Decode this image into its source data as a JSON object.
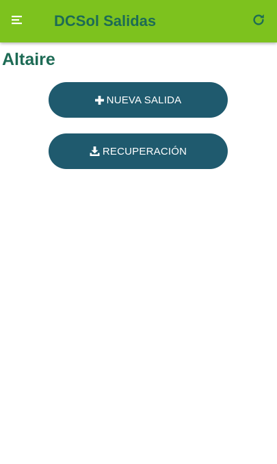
{
  "toolbar": {
    "title": "DCSol Salidas",
    "menu_icon": "menu-icon",
    "refresh_icon": "refresh-icon",
    "background_color": "#7dc21e",
    "title_color": "#1d6b55"
  },
  "main": {
    "station_name": "Altaire",
    "buttons": [
      {
        "label": "NUEVA SALIDA",
        "icon": "plus-icon"
      },
      {
        "label": "RECUPERACIÓN",
        "icon": "download-icon"
      }
    ],
    "button_color": "#1f5a6e"
  }
}
